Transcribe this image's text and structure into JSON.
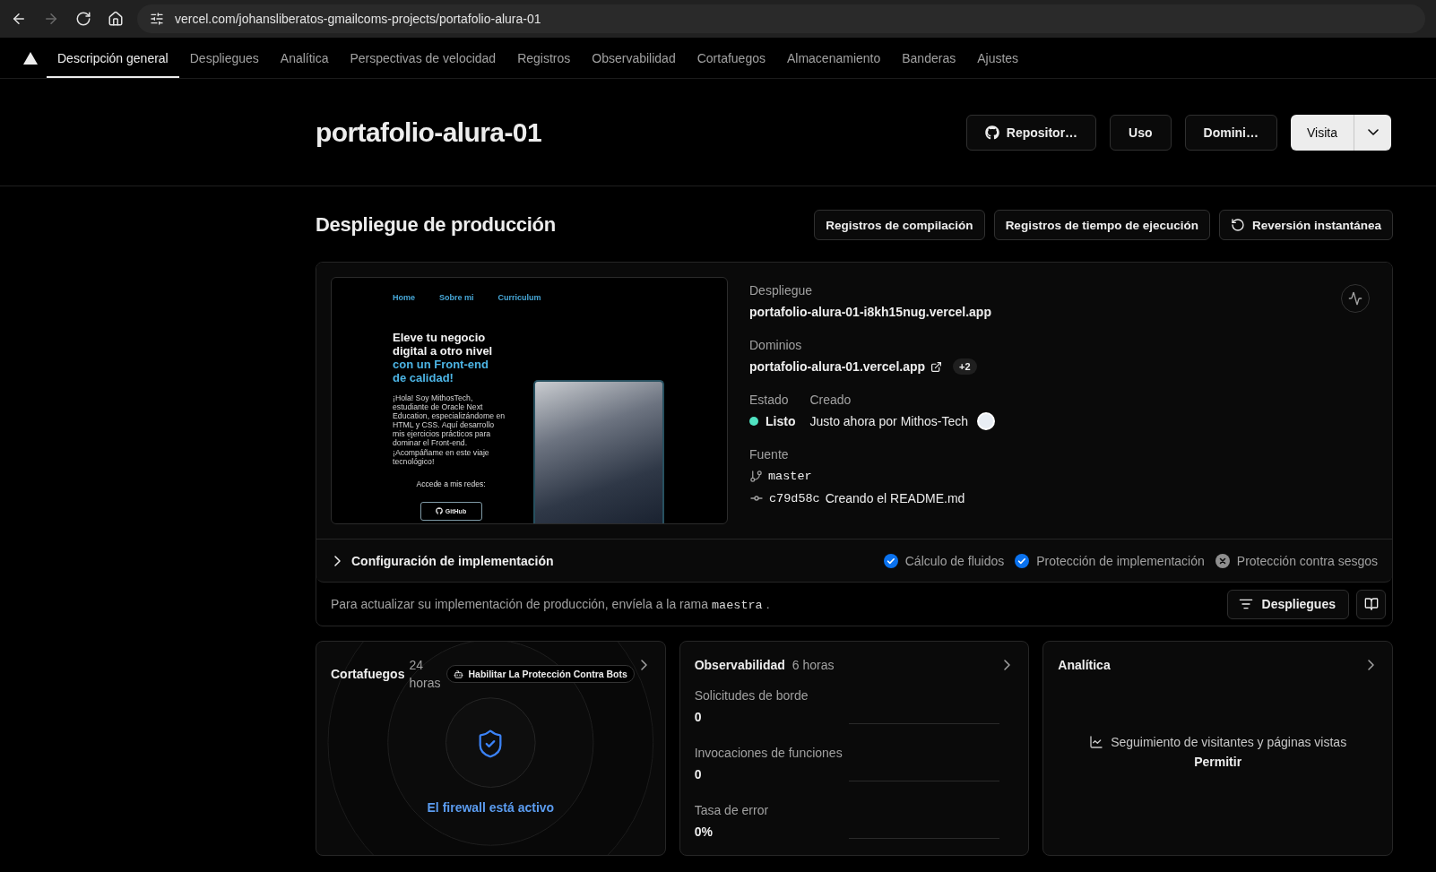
{
  "browser": {
    "buttons": [
      {
        "kind": "back",
        "disabled": false
      },
      {
        "kind": "forward",
        "disabled": true
      },
      {
        "kind": "reload",
        "disabled": false
      },
      {
        "kind": "home",
        "disabled": false
      }
    ],
    "url": "vercel.com/johansliberatos-gmailcoms-projects/portafolio-alura-01"
  },
  "nav": {
    "tabs": [
      {
        "label": "Descripción general",
        "selected": true
      },
      {
        "label": "Despliegues",
        "selected": false
      },
      {
        "label": "Analítica",
        "selected": false
      },
      {
        "label": "Perspectivas de velocidad",
        "selected": false
      },
      {
        "label": "Registros",
        "selected": false
      },
      {
        "label": "Observabilidad",
        "selected": false
      },
      {
        "label": "Cortafuegos",
        "selected": false
      },
      {
        "label": "Almacenamiento",
        "selected": false
      },
      {
        "label": "Banderas",
        "selected": false
      },
      {
        "label": "Ajustes",
        "selected": false
      }
    ]
  },
  "header": {
    "title": "portafolio-alura-01",
    "buttons": [
      {
        "kind": "repository",
        "label": "Repositor…"
      },
      {
        "kind": "usage",
        "label": "Uso"
      },
      {
        "kind": "domains",
        "label": "Domini…"
      }
    ],
    "visit": "Visita"
  },
  "production": {
    "title": "Despliegue de producción",
    "buttons": [
      {
        "kind": "build_logs",
        "label": "Registros de compilación"
      },
      {
        "kind": "runtime_logs",
        "label": "Registros de tiempo de ejecución"
      },
      {
        "kind": "rollback",
        "label": "Reversión instantánea"
      }
    ],
    "preview": {
      "nav_links": [
        "Home",
        "Sobre mi",
        "Curriculum"
      ],
      "headline": "Eleve tu negocio digital a otro nivel",
      "headline_accent": "con un Front-end de calidad!",
      "intro": "¡Hola! Soy MithosTech, estudiante de Oracle Next Education, especializándome en HTML y CSS. Aquí desarrollo mis ejercicios prácticos para dominar el Front-end. ¡Acompáñame en este viaje tecnológico!",
      "social_label": "Accede a mis redes:",
      "social_button": "GitHub"
    },
    "deployment": {
      "label": "Despliegue",
      "url": "portafolio-alura-01-i8kh15nug.vercel.app"
    },
    "domains": {
      "label": "Dominios",
      "url": "portafolio-alura-01.vercel.app",
      "extra": "+2"
    },
    "status": {
      "label": "Estado",
      "value": "Listo",
      "color": "#50e3c2"
    },
    "created": {
      "label": "Creado",
      "value": "Justo ahora por Mithos-Tech"
    },
    "source": {
      "label": "Fuente",
      "branch": "master",
      "commit": "c79d58c",
      "message": "Creando el README.md"
    },
    "config": {
      "title": "Configuración de implementación",
      "expanded": false,
      "features": [
        {
          "label": "Cálculo de fluidos",
          "enabled": true
        },
        {
          "label": "Protección de implementación",
          "enabled": true
        },
        {
          "label": "Protección contra sesgos",
          "enabled": false
        }
      ]
    },
    "hint": {
      "text": "Para actualizar su implementación de producción, envíela a la rama",
      "branch": "maestra",
      "end": "."
    },
    "deployments_button": "Despliegues"
  },
  "cards": [
    {
      "kind": "firewall",
      "title": "Cortafuegos",
      "period": "24 horas",
      "action": "Habilitar La Protección Contra Bots",
      "status": "El firewall está activo"
    },
    {
      "kind": "observability",
      "title": "Observabilidad",
      "period": "6 horas",
      "metrics": [
        {
          "label": "Solicitudes de borde",
          "value": "0"
        },
        {
          "label": "Invocaciones de funciones",
          "value": "0"
        },
        {
          "label": "Tasa de error",
          "value": "0%"
        }
      ]
    },
    {
      "kind": "analytics",
      "title": "Analítica",
      "message": "Seguimiento de visitantes y páginas vistas",
      "action": "Permitir"
    }
  ]
}
